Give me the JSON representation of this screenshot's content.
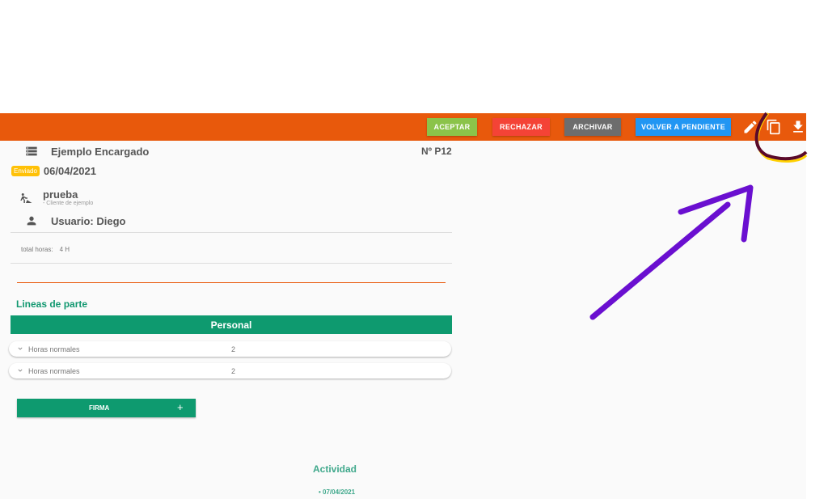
{
  "toolbar": {
    "accept_label": "ACEPTAR",
    "reject_label": "RECHAZAR",
    "archive_label": "ARCHIVAR",
    "pending_label": "VOLVER A PENDIENTE",
    "icons": [
      "pencil-icon",
      "copy-icon",
      "download-icon"
    ],
    "color": "#e8590c"
  },
  "header": {
    "title": "Ejemplo Encargado",
    "number": "Nº P12",
    "status_badge": "Enviado",
    "date": "06/04/2021",
    "worker": "prueba",
    "client": "- Cliente de ejemplo",
    "user": "Usuario: Diego"
  },
  "totals": {
    "label": "total horas:",
    "value": "4 H"
  },
  "lines": {
    "section_title": "Lineas de parte",
    "group_header": "Personal",
    "items": [
      {
        "label": "Horas normales",
        "value": "2"
      },
      {
        "label": "Horas normales",
        "value": "2"
      }
    ]
  },
  "firma": {
    "label": "FIRMA",
    "plus": "+"
  },
  "activity": {
    "title": "Actividad",
    "first_date": "• 07/04/2021"
  }
}
